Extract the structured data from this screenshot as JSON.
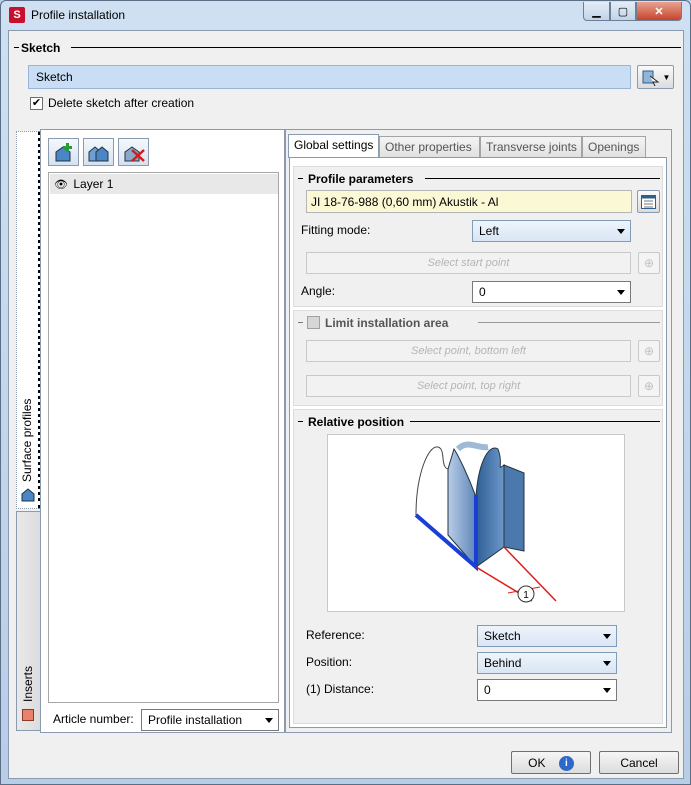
{
  "window": {
    "title": "Profile installation"
  },
  "sketch": {
    "group_title": "Sketch",
    "field_value": "Sketch",
    "delete_checkbox_label": "Delete sketch after creation",
    "delete_checked": true
  },
  "side_tabs": [
    "Surface profiles",
    "Inserts"
  ],
  "layers": {
    "items": [
      {
        "label": "Layer 1"
      }
    ]
  },
  "article": {
    "label": "Article number:",
    "value": "Profile installation"
  },
  "tabs": [
    {
      "label": "Global settings",
      "active": true
    },
    {
      "label": "Other properties"
    },
    {
      "label": "Transverse joints"
    },
    {
      "label": "Openings"
    }
  ],
  "profile_params": {
    "title": "Profile parameters",
    "profile_value": "JI 18-76-988 (0,60 mm) Akustik - Al",
    "fitting_label": "Fitting mode:",
    "fitting_value": "Left",
    "start_point_button": "Select start point",
    "angle_label": "Angle:",
    "angle_value": "0"
  },
  "limit_area": {
    "title": "Limit installation area",
    "checked": false,
    "bottom_left_button": "Select point, bottom left",
    "top_right_button": "Select point, top right"
  },
  "relative_position": {
    "title": "Relative position",
    "image_marker": "1",
    "reference_label": "Reference:",
    "reference_value": "Sketch",
    "position_label": "Position:",
    "position_value": "Behind",
    "distance_label": "(1) Distance:",
    "distance_value": "0"
  },
  "footer": {
    "ok_label": "OK",
    "cancel_label": "Cancel"
  },
  "colors": {
    "accent_field": "#c9def5",
    "highlight_field": "#fbf8d6",
    "close_button": "#c8442c"
  }
}
